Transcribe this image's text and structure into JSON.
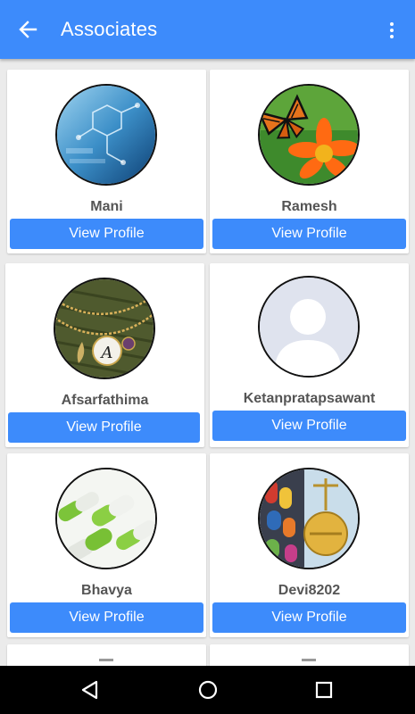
{
  "header": {
    "title": "Associates",
    "back_icon": "arrow-left-icon",
    "menu_icon": "more-vert-icon"
  },
  "colors": {
    "primary": "#3d8bfb",
    "background": "#ebebeb",
    "nav_bar": "#000000"
  },
  "associates": [
    {
      "name": "Mani",
      "button": "View Profile",
      "image": "chemistry-molecule"
    },
    {
      "name": "Ramesh",
      "button": "View Profile",
      "image": "butterfly-on-flower"
    },
    {
      "name": "Afsarfathima",
      "button": "View Profile",
      "image": "letter-pendant-necklace"
    },
    {
      "name": "Ketanpratapsawant",
      "button": "View Profile",
      "image": "default-avatar"
    },
    {
      "name": "Bhavya",
      "button": "View Profile",
      "image": "green-white-capsules"
    },
    {
      "name": "Devi8202",
      "button": "View Profile",
      "image": "pills-and-scale"
    }
  ],
  "navigation": {
    "back": "triangle-back-icon",
    "home": "circle-home-icon",
    "recents": "square-recents-icon"
  }
}
